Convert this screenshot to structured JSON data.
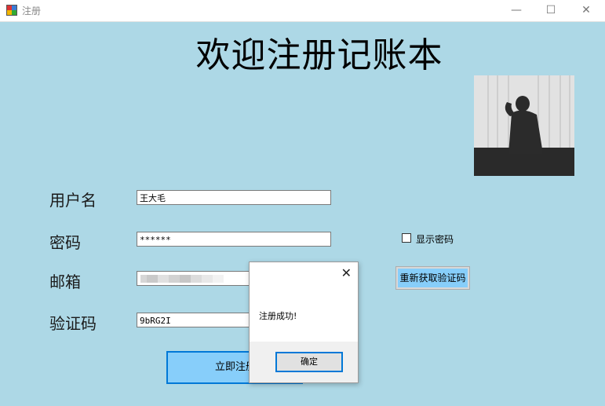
{
  "window": {
    "title": "注册",
    "minimize_glyph": "—",
    "maximize_glyph": "☐",
    "close_glyph": "✕"
  },
  "form": {
    "heading": "欢迎注册记账本",
    "username_label": "用户名",
    "username_value": "王大毛",
    "password_label": "密码",
    "password_value": "******",
    "show_password_label": "显示密码",
    "show_password_checked": false,
    "email_label": "邮箱",
    "captcha_label": "验证码",
    "captcha_value": "9bRG2I",
    "refresh_button": "重新获取验证码",
    "register_button": "立即注册"
  },
  "dialog": {
    "close_glyph": "✕",
    "message": "注册成功!",
    "ok_button": "确定"
  },
  "colors": {
    "background": "#add8e6",
    "button_blue": "#87cefa",
    "focus_border": "#0078d7"
  }
}
